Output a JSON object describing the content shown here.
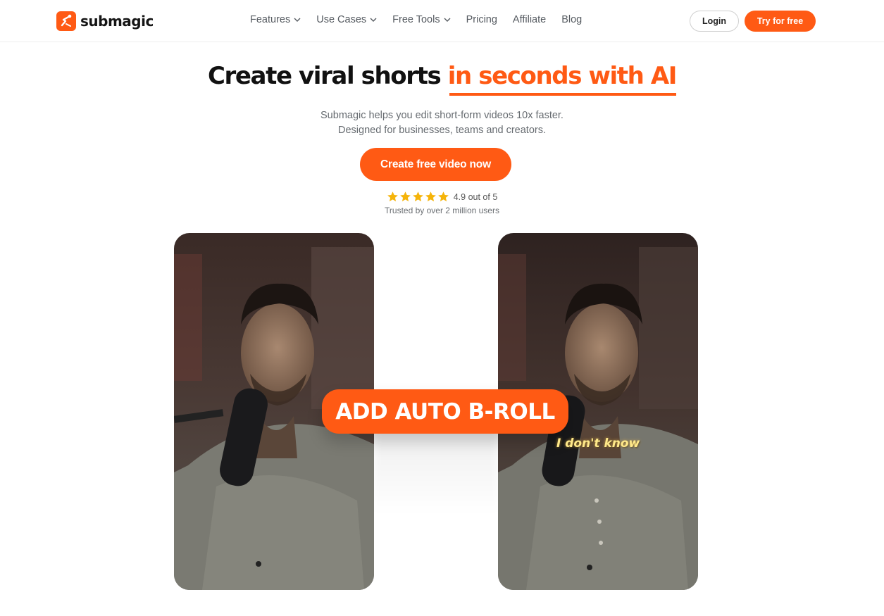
{
  "brand": {
    "name": "submagic",
    "accent": "#ff5a14"
  },
  "nav": {
    "items": [
      {
        "label": "Features",
        "dropdown": true
      },
      {
        "label": "Use Cases",
        "dropdown": true
      },
      {
        "label": "Free Tools",
        "dropdown": true
      },
      {
        "label": "Pricing",
        "dropdown": false
      },
      {
        "label": "Affiliate",
        "dropdown": false
      },
      {
        "label": "Blog",
        "dropdown": false
      }
    ],
    "login_label": "Login",
    "try_label": "Try for free"
  },
  "hero": {
    "headline_plain": "Create viral shorts ",
    "headline_accent": "in seconds with AI",
    "subtext_line1": "Submagic helps you edit short-form videos 10x faster.",
    "subtext_line2": "Designed for businesses, teams and creators.",
    "cta_label": "Create free video now",
    "rating_value": 4.9,
    "rating_text": "4.9 out of 5",
    "stars": 5,
    "trusted_text": "Trusted by over 2 million users"
  },
  "demo": {
    "feature_label": "ADD AUTO B-ROLL",
    "caption_text": "I don't know"
  },
  "icons": {
    "logo": "submagic-logo-icon",
    "chevron": "chevron-down-icon",
    "star": "star-icon"
  }
}
